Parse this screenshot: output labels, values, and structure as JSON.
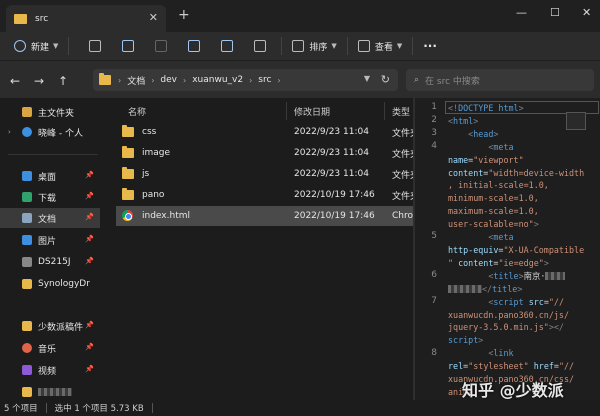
{
  "window": {
    "tab_title": "src",
    "new_tab": "+",
    "minimize": "—",
    "maximize": "☐",
    "close": "✕"
  },
  "toolbar": {
    "new_label": "新建",
    "sort_label": "排序",
    "view_label": "查看",
    "more_label": "···"
  },
  "address": {
    "back": "←",
    "forward": "→",
    "up": "↑",
    "crumbs": [
      "文档",
      "dev",
      "xuanwu_v2",
      "src"
    ],
    "search_placeholder": "在 src 中搜索"
  },
  "sidebar": {
    "items": [
      {
        "label": "主文件夹",
        "icon": "home-icon",
        "color": "#d9a441"
      },
      {
        "label": "晓峰 - 个人",
        "icon": "cloud-icon",
        "color": "#3d8fe0"
      },
      {
        "label": "桌面",
        "icon": "desktop-icon",
        "color": "#3d8fe0"
      },
      {
        "label": "下载",
        "icon": "download-icon",
        "color": "#2fa36b"
      },
      {
        "label": "文档",
        "icon": "document-icon",
        "color": "#8aa4c0"
      },
      {
        "label": "图片",
        "icon": "pictures-icon",
        "color": "#3d8fe0"
      },
      {
        "label": "DS215J",
        "icon": "drive-icon",
        "color": "#888888"
      },
      {
        "label": "SynologyDr",
        "icon": "folder-icon",
        "color": "#e8b84a"
      },
      {
        "label": "少数派稿件",
        "icon": "folder-icon",
        "color": "#e8b84a"
      },
      {
        "label": "音乐",
        "icon": "music-icon",
        "color": "#e0644a"
      },
      {
        "label": "视频",
        "icon": "video-icon",
        "color": "#8f5ad8"
      }
    ]
  },
  "columns": {
    "name": "名称",
    "date": "修改日期",
    "type": "类型"
  },
  "files": [
    {
      "name": "css",
      "date": "2022/9/23 11:04",
      "type": "文件夹",
      "kind": "folder"
    },
    {
      "name": "image",
      "date": "2022/9/23 11:04",
      "type": "文件夹",
      "kind": "folder"
    },
    {
      "name": "js",
      "date": "2022/9/23 11:04",
      "type": "文件夹",
      "kind": "folder"
    },
    {
      "name": "pano",
      "date": "2022/10/19 17:46",
      "type": "文件夹",
      "kind": "folder"
    },
    {
      "name": "index.html",
      "date": "2022/10/19 17:46",
      "type": "Chrome HTML Document",
      "kind": "chrome"
    }
  ],
  "preview": {
    "line_numbers": [
      "1",
      "2",
      "3",
      "4",
      "5",
      "6",
      "7",
      "8"
    ]
  },
  "status": {
    "count": "5 个项目",
    "selected": "选中 1 个项目 5.73 KB"
  },
  "watermark": "知乎 @少数派"
}
